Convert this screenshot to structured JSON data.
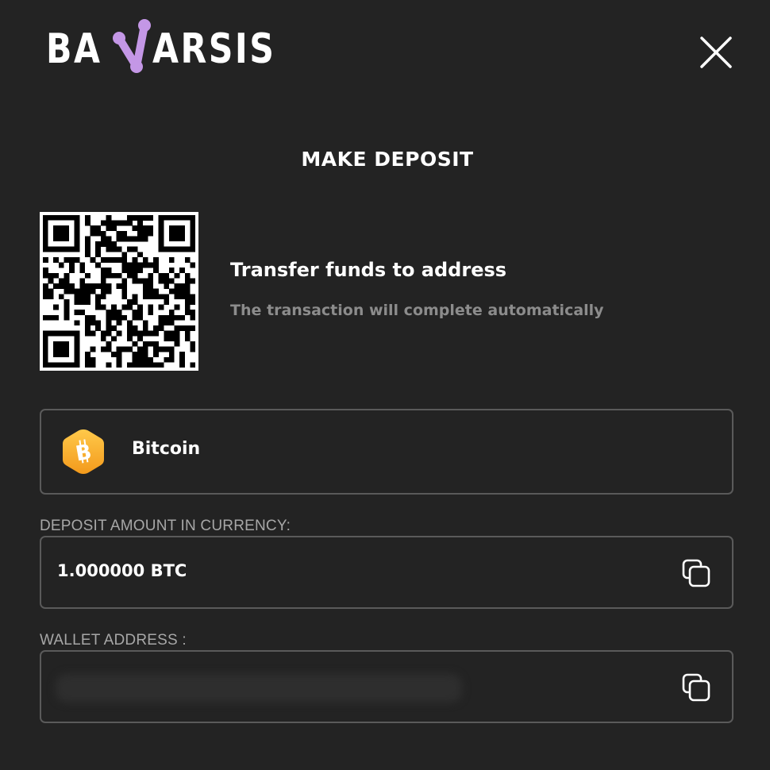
{
  "brand": {
    "logo_left": "BA",
    "logo_right": "ARSIS",
    "logo_mark_color": "#c497e6"
  },
  "close_icon": "close-icon",
  "title": "MAKE DEPOSIT",
  "transfer": {
    "title": "Transfer funds to address",
    "subtitle": "The transaction will complete automatically"
  },
  "currency": {
    "name": "Bitcoin",
    "icon": "bitcoin-icon",
    "icon_color": "#f5a623"
  },
  "amount": {
    "label": "DEPOSIT AMOUNT IN CURRENCY:",
    "value": "1.000000 BTC",
    "copy_icon": "copy-icon"
  },
  "wallet": {
    "label": "WALLET ADDRESS :",
    "value": "",
    "copy_icon": "copy-icon"
  },
  "colors": {
    "background": "#232323",
    "border": "#5a5a5a",
    "muted_text": "#8c8c8c",
    "label_text": "#a7a7a7"
  }
}
